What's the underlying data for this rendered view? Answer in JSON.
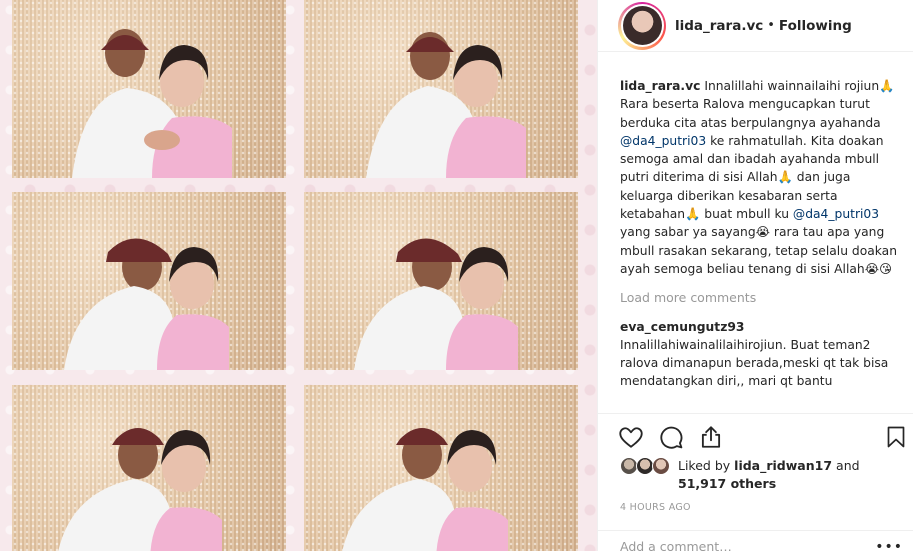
{
  "header": {
    "username": "lida_rara.vc",
    "separator": "•",
    "follow_status": "Following"
  },
  "caption": {
    "username": "lida_rara.vc",
    "part1": "Innalillahi wainnailaihi rojiun🙏 Rara beserta Ralova mengucapkan turut berduka cita atas berpulangnya ayahanda ",
    "mention1": "@da4_putri03",
    "part2": " ke rahmatullah. Kita doakan semoga amal dan ibadah ayahanda mbull putri diterima di sisi Allah🙏 dan juga keluarga diberikan kesabaran serta ketabahan🙏 buat mbull ku ",
    "mention2": "@da4_putri03",
    "part3": " yang sabar ya sayang😭 rara tau apa yang mbull rasakan sekarang, tetap selalu doakan ayah semoga beliau tenang di sisi Allah😭😘"
  },
  "load_more": "Load more comments",
  "comment": {
    "username": "eva_cemungutz93",
    "text": "Innalillahiwainalilaihirojiun. Buat teman2 ralova dimanapun berada,meski qt tak bisa mendatangkan diri,, mari qt bantu"
  },
  "likes": {
    "prefix": "Liked by",
    "user": "lida_ridwan17",
    "and": "and",
    "others": "51,917 others"
  },
  "timestamp": "4 HOURS AGO",
  "add_comment_placeholder": "Add a comment…",
  "more_options": "•••",
  "icons": [
    "heart-icon",
    "comment-icon",
    "share-icon",
    "bookmark-icon"
  ],
  "colors": {
    "mention": "#003569",
    "muted": "#999999",
    "text": "#262626"
  }
}
